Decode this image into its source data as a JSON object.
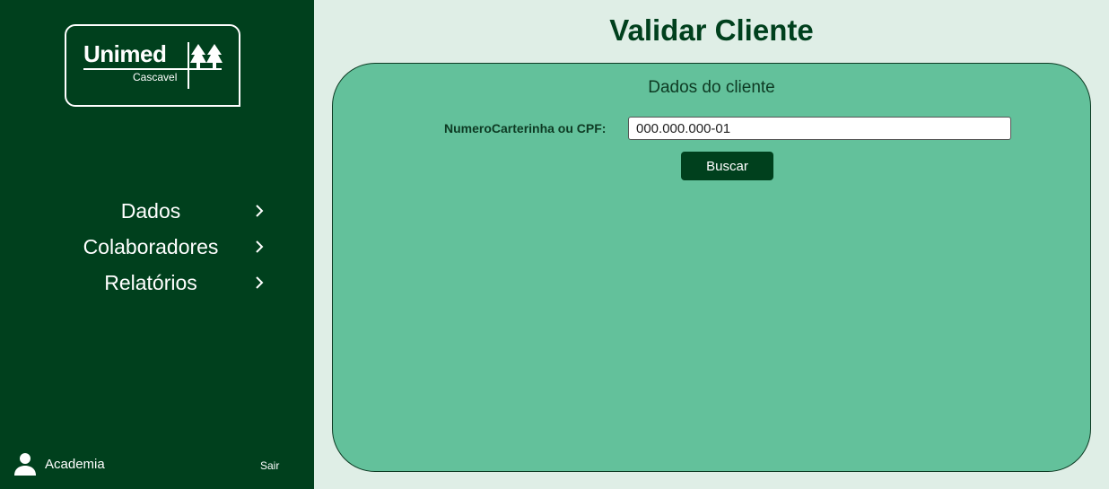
{
  "logo": {
    "brand": "Unimed",
    "subtitle": "Cascavel"
  },
  "sidebar": {
    "items": [
      {
        "label": "Dados",
        "icon": "chevron-right-icon"
      },
      {
        "label": "Colaboradores",
        "icon": "chevron-right-icon"
      },
      {
        "label": "Relatórios",
        "icon": "chevron-right-icon"
      }
    ],
    "user": {
      "name": "Academia",
      "icon": "user-icon"
    },
    "logout_label": "Sair"
  },
  "main": {
    "title": "Validar Cliente",
    "panel": {
      "title": "Dados do cliente",
      "field_label": "NumeroCarterinha ou CPF:",
      "field_value": "000.000.000-01",
      "button_label": "Buscar"
    }
  },
  "colors": {
    "sidebar_bg": "#00401d",
    "page_bg": "#dfeee6",
    "panel_bg": "#63c19b",
    "accent": "#00401d"
  }
}
